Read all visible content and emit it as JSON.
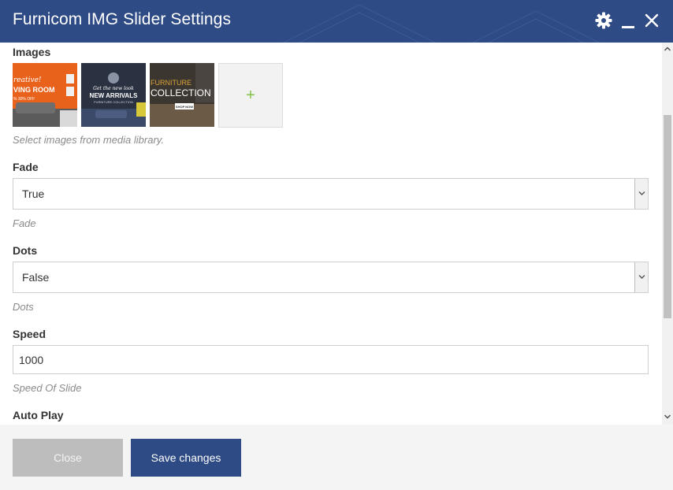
{
  "window": {
    "title": "Furnicom IMG Slider Settings",
    "accent_color": "#2e4b85"
  },
  "header_icons": {
    "settings": "gear-icon",
    "minimize": "minimize-icon",
    "close": "close-icon"
  },
  "images": {
    "label": "Images",
    "add_symbol": "+",
    "help": "Select images from media library.",
    "thumbnails": [
      {
        "lines": [
          "reative!",
          "VING ROOM",
          "% 30% OFF"
        ]
      },
      {
        "lines": [
          "Get the new look",
          "NEW ARRIVALS",
          "FURNITURE COLLECTION"
        ]
      },
      {
        "lines": [
          "FURNITURE",
          "COLLECTION",
          "SHOP NOW"
        ]
      }
    ]
  },
  "fade": {
    "label": "Fade",
    "value": "True",
    "help": "Fade"
  },
  "dots": {
    "label": "Dots",
    "value": "False",
    "help": "Dots"
  },
  "speed": {
    "label": "Speed",
    "value": "1000",
    "help": "Speed Of Slide"
  },
  "autoplay": {
    "label": "Auto Play"
  },
  "footer": {
    "close_label": "Close",
    "save_label": "Save changes"
  }
}
